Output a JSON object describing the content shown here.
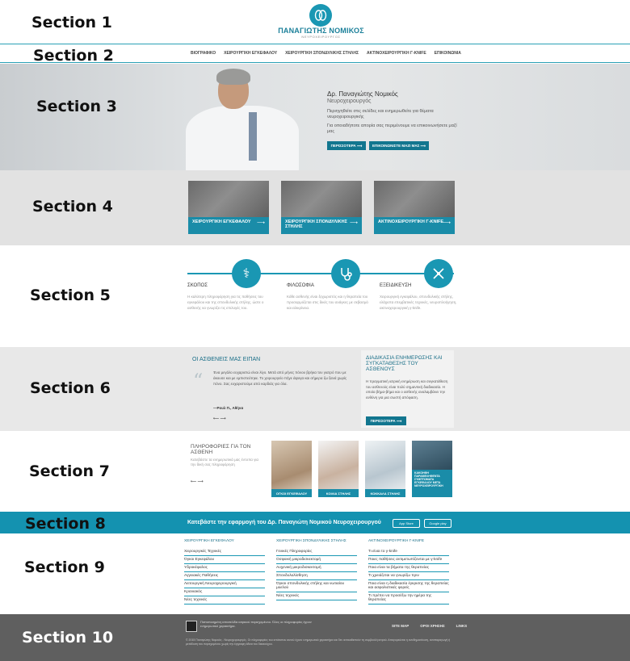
{
  "colors": {
    "accent": "#1a97b3",
    "dark_accent": "#12768f",
    "footer": "#5f5f5f"
  },
  "section_labels": [
    "Section 1",
    "Section 2",
    "Section 3",
    "Section 4",
    "Section 5",
    "Section 6",
    "Section 7",
    "Section 8",
    "Section 9",
    "Section 10"
  ],
  "header": {
    "logo_icon": "brain-logo-icon",
    "name": "ΠΑΝΑΓΙΩΤΗΣ ΝΟΜΙΚΟΣ",
    "subtitle": "ΝΕΥΡΟΧΕΙΡΟΥΡΓΟΣ"
  },
  "nav": [
    "ΒΙΟΓΡΑΦΙΚΟ",
    "ΧΕΙΡΟΥΡΓΙΚΗ ΕΓΚΕΦΑΛΟΥ",
    "ΧΕΙΡΟΥΡΓΙΚΗ ΣΠΟΝΔΥΛΙΚΗΣ ΣΤΗΛΗΣ",
    "ΑΚΤΙΝΟΧΕΙΡΟΥΡΓΙΚΗ Γ-KNIFE",
    "ΕΠΙΚΟΙΝΩΝΙΑ"
  ],
  "hero": {
    "title": "Δρ. Παναγιώτης Νομικός",
    "subtitle": "Νευροχειρουργός",
    "p1": "Περιηγηθείτε στις σελίδες και ενημερωθείτε για θέματα νευροχειρουργικής",
    "p2": "Για οποιαδήποτε απορία σας περιμένουμε να επικοινωνήσετε μαζί μας",
    "btn1": "ΠΕΡΙΣΣΟΤΕΡΑ ⟶",
    "btn2": "ΕΠΙΚΟΙΝΩΝΙΣΤΕ ΜΑΖΙ ΜΑΣ ⟶"
  },
  "services": [
    {
      "label": "ΧΕΙΡΟΥΡΓΙΚΗ ΕΓΚΕΦΑΛΟΥ"
    },
    {
      "label": "ΧΕΙΡΟΥΡΓΙΚΗ ΣΠΟΝΔΥΛΙΚΗΣ ΣΤΗΛΗΣ"
    },
    {
      "label": "ΑΚΤΙΝΟΧΕΙΡΟΥΡΓΙΚΗ Γ-KNIFE"
    }
  ],
  "pillars": [
    {
      "title": "ΣΚΟΠΟΣ",
      "icon": "caduceus-icon",
      "text": "Η καλύτερη πληροφόρηση για τις παθήσεις του εγκεφάλου και της σπονδυλικής στήλης, ώστε ο ασθενής να γνωρίζει τις επιλογές του."
    },
    {
      "title": "ΦΙΛΟΣΟΦΙΑ",
      "icon": "stethoscope-icon",
      "text": "Κάθε ασθενής είναι ξεχωριστός και η θεραπεία του προσαρμόζεται στις δικές του ανάγκες με σεβασμό και ειλικρίνεια."
    },
    {
      "title": "ΕΞΕΙΔΙΚΕΥΣΗ",
      "icon": "surgical-tools-icon",
      "text": "Χειρουργική εγκεφάλου, σπονδυλικής στήλης, ελάχιστα επεμβατικές τεχνικές, νευροπλοήγηση, ακτινοχειρουργική γ-knife."
    }
  ],
  "testimonials": {
    "title": "ΟΙ ΑΣΘΕΝΕΙΣ ΜΑΣ ΕΙΠΑΝ",
    "quote": "Ένα μεγάλο ευχαριστώ είναι λίγο. Μετά από μήνες πόνου βρήκα τον γιατρό που με άκουσε και με εμπιστεύτηκε. Το χειρουργείο πήγε άψογα και σήμερα ζω ξανά χωρίς πόνο. Σας ευχαριστούμε από καρδιάς για όλα.",
    "author": "—Ρουλ Π., Αθήνα",
    "nav": "⟵   ⟶"
  },
  "info_panel": {
    "title": "ΔΙΑΔΙΚΑΣΙΑ ΕΝΗΜΕΡΩΣΗΣ ΚΑΙ ΣΥΓΚΑΤΑΘΕΣΗΣ ΤΟΥ ΑΣΘΕΝΟΥΣ",
    "text": "Η πραγματική ιατρική ενημέρωση και συγκατάθεση του ασθενούς είναι πολύ σημαντική διαδικασία. Η οποία βήμα-βήμα και ο ασθενής αναλαμβάνει την ευθύνη για μια σωστή απόφαση.",
    "button": "ΠΕΡΙΣΣΟΤΕΡΑ ⟶"
  },
  "patient_info": {
    "title": "ΠΛΗΡΟΦΟΡΙΕΣ ΓΙΑ ΤΟΝ ΑΣΘΕΝΗ",
    "text": "Κατεβάστε τα ενημερωτικά μας έντυπα για την δική σας πληροφόρηση",
    "nav": "⟵   ⟶",
    "cards": [
      "ΟΓΚΟΙ ΕΓΚΕΦΑΛΟΥ",
      "ΚΟΙΛΙΑ ΣΤΗΛΗΣ",
      "ΚΟΚΚΑΛΑ ΣΤΗΛΗΣ",
      "ΚΑΚΟΗΘΗ ΠΑΡΑΜΕΛΗΘΕΝΤΑ ΣΥΜΠΤΩΜΑΤΑ ΕΓΚΕΦΑΛΟΥ ΜΕΤΑ ΝΕΥΡΟΧΕΙΡΟΥΡΓΙΚΗ"
    ]
  },
  "app_banner": {
    "text": "Κατεβάστε την εφαρμογή του Δρ. Παναγιώτη Νομικού Νευροχειρουργού",
    "app_store": "App Store",
    "google_play": "Google play"
  },
  "footer_links": [
    {
      "title": "ΧΕΙΡΟΥΡΓΙΚΗ ΕΓΚΕΦΑΛΟΥ",
      "items": [
        "Χειρουργικές Τεχνικές",
        "Όγκοι Εγκεφάλου",
        "Υδροκέφαλος",
        "Αγγειακές Παθήσεις",
        "Λειτουργική Νευροχειρουργική",
        "Κρανιακός",
        "Νέες τεχνικές"
      ]
    },
    {
      "title": "ΧΕΙΡΟΥΡΓΙΚΗ ΣΠΟΝΔΥΛΙΚΗΣ ΣΤΗΛΗΣ",
      "items": [
        "Γενικές Πληροφορίες",
        "Οσφυική μικροδισκεκτομή",
        "Αυχενική μικροδισκεκτομή",
        "Σπονδυλολίσθηση",
        "Όγκοι σπονδυλικής στήλης και νωτιαίου μυελού",
        "Νέες τεχνικές"
      ]
    },
    {
      "title": "ΑΚΤΙΝΟΧΕΙΡΟΥΡΓΙΚΗ Γ-KNIFE",
      "items": [
        "Τι είναι το γ-knife",
        "Ποιες παθήσεις αντιμετωπίζονται με γ-knife",
        "Ποια είναι τα βήματα της θεραπείας",
        "Τι χρειάζεται να γνωρίζω πριν",
        "Ποια είναι η διαδικασία έγκρισης της θεραπείας και ασφαλιστικές φορείς",
        "Τι πρέπει να προσέξω την ημέρα της θεραπείας"
      ]
    }
  ],
  "footer": {
    "notice": "Πιστοποιημένη ιστοσελίδα ιατρικού περιεχομένου. Όλες οι πληροφορίες έχουν ενημερωτικό χαρακτήρα.",
    "links": [
      "SITE MAP",
      "ΟΡΟΙ ΧΡΗΣΗΣ",
      "LINKS"
    ],
    "legal": "© 2015 Παναγιώτης Νομικός - Νευροχειρουργός. Οι πληροφορίες του ιστότοπου αυτού έχουν ενημερωτικό χαρακτήρα και δεν αντικαθιστούν τη συμβουλή ιατρού. Απαγορεύεται η αναδημοσίευση, αναπαραγωγή ή μετάδοση του περιεχομένου χωρίς την έγγραφη άδεια του δικαιούχου."
  }
}
